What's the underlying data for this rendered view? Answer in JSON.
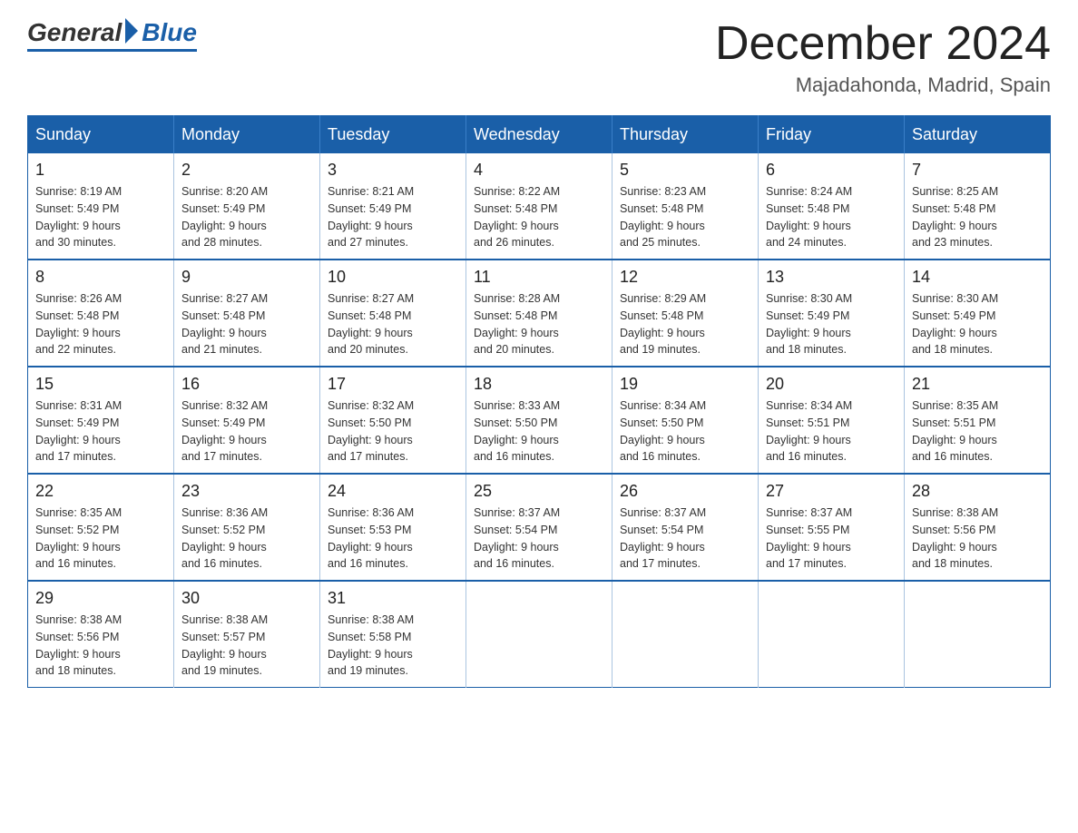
{
  "header": {
    "logo": {
      "text_general": "General",
      "text_blue": "Blue"
    },
    "title": "December 2024",
    "location": "Majadahonda, Madrid, Spain"
  },
  "calendar": {
    "weekdays": [
      "Sunday",
      "Monday",
      "Tuesday",
      "Wednesday",
      "Thursday",
      "Friday",
      "Saturday"
    ],
    "weeks": [
      [
        {
          "day": "1",
          "sunrise": "8:19 AM",
          "sunset": "5:49 PM",
          "daylight": "9 hours and 30 minutes."
        },
        {
          "day": "2",
          "sunrise": "8:20 AM",
          "sunset": "5:49 PM",
          "daylight": "9 hours and 28 minutes."
        },
        {
          "day": "3",
          "sunrise": "8:21 AM",
          "sunset": "5:49 PM",
          "daylight": "9 hours and 27 minutes."
        },
        {
          "day": "4",
          "sunrise": "8:22 AM",
          "sunset": "5:48 PM",
          "daylight": "9 hours and 26 minutes."
        },
        {
          "day": "5",
          "sunrise": "8:23 AM",
          "sunset": "5:48 PM",
          "daylight": "9 hours and 25 minutes."
        },
        {
          "day": "6",
          "sunrise": "8:24 AM",
          "sunset": "5:48 PM",
          "daylight": "9 hours and 24 minutes."
        },
        {
          "day": "7",
          "sunrise": "8:25 AM",
          "sunset": "5:48 PM",
          "daylight": "9 hours and 23 minutes."
        }
      ],
      [
        {
          "day": "8",
          "sunrise": "8:26 AM",
          "sunset": "5:48 PM",
          "daylight": "9 hours and 22 minutes."
        },
        {
          "day": "9",
          "sunrise": "8:27 AM",
          "sunset": "5:48 PM",
          "daylight": "9 hours and 21 minutes."
        },
        {
          "day": "10",
          "sunrise": "8:27 AM",
          "sunset": "5:48 PM",
          "daylight": "9 hours and 20 minutes."
        },
        {
          "day": "11",
          "sunrise": "8:28 AM",
          "sunset": "5:48 PM",
          "daylight": "9 hours and 20 minutes."
        },
        {
          "day": "12",
          "sunrise": "8:29 AM",
          "sunset": "5:48 PM",
          "daylight": "9 hours and 19 minutes."
        },
        {
          "day": "13",
          "sunrise": "8:30 AM",
          "sunset": "5:49 PM",
          "daylight": "9 hours and 18 minutes."
        },
        {
          "day": "14",
          "sunrise": "8:30 AM",
          "sunset": "5:49 PM",
          "daylight": "9 hours and 18 minutes."
        }
      ],
      [
        {
          "day": "15",
          "sunrise": "8:31 AM",
          "sunset": "5:49 PM",
          "daylight": "9 hours and 17 minutes."
        },
        {
          "day": "16",
          "sunrise": "8:32 AM",
          "sunset": "5:49 PM",
          "daylight": "9 hours and 17 minutes."
        },
        {
          "day": "17",
          "sunrise": "8:32 AM",
          "sunset": "5:50 PM",
          "daylight": "9 hours and 17 minutes."
        },
        {
          "day": "18",
          "sunrise": "8:33 AM",
          "sunset": "5:50 PM",
          "daylight": "9 hours and 16 minutes."
        },
        {
          "day": "19",
          "sunrise": "8:34 AM",
          "sunset": "5:50 PM",
          "daylight": "9 hours and 16 minutes."
        },
        {
          "day": "20",
          "sunrise": "8:34 AM",
          "sunset": "5:51 PM",
          "daylight": "9 hours and 16 minutes."
        },
        {
          "day": "21",
          "sunrise": "8:35 AM",
          "sunset": "5:51 PM",
          "daylight": "9 hours and 16 minutes."
        }
      ],
      [
        {
          "day": "22",
          "sunrise": "8:35 AM",
          "sunset": "5:52 PM",
          "daylight": "9 hours and 16 minutes."
        },
        {
          "day": "23",
          "sunrise": "8:36 AM",
          "sunset": "5:52 PM",
          "daylight": "9 hours and 16 minutes."
        },
        {
          "day": "24",
          "sunrise": "8:36 AM",
          "sunset": "5:53 PM",
          "daylight": "9 hours and 16 minutes."
        },
        {
          "day": "25",
          "sunrise": "8:37 AM",
          "sunset": "5:54 PM",
          "daylight": "9 hours and 16 minutes."
        },
        {
          "day": "26",
          "sunrise": "8:37 AM",
          "sunset": "5:54 PM",
          "daylight": "9 hours and 17 minutes."
        },
        {
          "day": "27",
          "sunrise": "8:37 AM",
          "sunset": "5:55 PM",
          "daylight": "9 hours and 17 minutes."
        },
        {
          "day": "28",
          "sunrise": "8:38 AM",
          "sunset": "5:56 PM",
          "daylight": "9 hours and 18 minutes."
        }
      ],
      [
        {
          "day": "29",
          "sunrise": "8:38 AM",
          "sunset": "5:56 PM",
          "daylight": "9 hours and 18 minutes."
        },
        {
          "day": "30",
          "sunrise": "8:38 AM",
          "sunset": "5:57 PM",
          "daylight": "9 hours and 19 minutes."
        },
        {
          "day": "31",
          "sunrise": "8:38 AM",
          "sunset": "5:58 PM",
          "daylight": "9 hours and 19 minutes."
        },
        null,
        null,
        null,
        null
      ]
    ],
    "sunrise_label": "Sunrise:",
    "sunset_label": "Sunset:",
    "daylight_label": "Daylight:"
  }
}
